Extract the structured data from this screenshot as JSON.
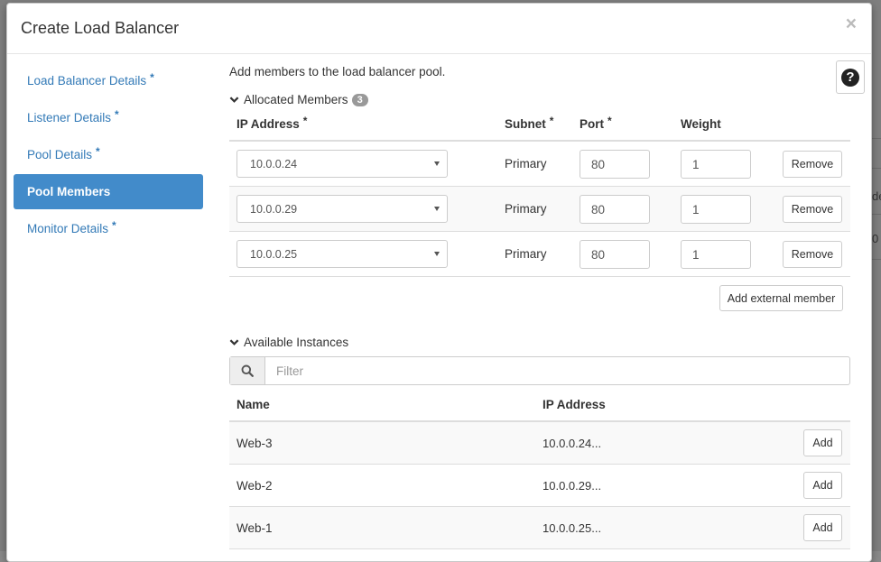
{
  "background": {
    "fragments": [
      "de",
      "0"
    ]
  },
  "modal": {
    "title": "Create Load Balancer",
    "close_label": "×"
  },
  "sidebar": {
    "items": [
      {
        "label": "Load Balancer Details",
        "required": "*"
      },
      {
        "label": "Listener Details",
        "required": "*"
      },
      {
        "label": "Pool Details",
        "required": "*"
      },
      {
        "label": "Pool Members",
        "required": ""
      },
      {
        "label": "Monitor Details",
        "required": "*"
      }
    ],
    "active_index": 3
  },
  "help": {
    "icon": "question-circle-icon",
    "label": "?"
  },
  "content": {
    "intro": "Add members to the load balancer pool.",
    "allocated": {
      "title": "Allocated Members",
      "count": "3",
      "headers": {
        "ip": "IP Address",
        "subnet": "Subnet",
        "port": "Port",
        "weight": "Weight",
        "required": "*"
      },
      "rows": [
        {
          "ip": "10.0.0.24",
          "subnet": "Primary",
          "port": "80",
          "weight": "1",
          "action": "Remove"
        },
        {
          "ip": "10.0.0.29",
          "subnet": "Primary",
          "port": "80",
          "weight": "1",
          "action": "Remove"
        },
        {
          "ip": "10.0.0.25",
          "subnet": "Primary",
          "port": "80",
          "weight": "1",
          "action": "Remove"
        }
      ],
      "add_external": "Add external member"
    },
    "available": {
      "title": "Available Instances",
      "filter_placeholder": "Filter",
      "headers": {
        "name": "Name",
        "ip": "IP Address"
      },
      "rows": [
        {
          "name": "Web-3",
          "ip": "10.0.0.24...",
          "action": "Add"
        },
        {
          "name": "Web-2",
          "ip": "10.0.0.29...",
          "action": "Add"
        },
        {
          "name": "Web-1",
          "ip": "10.0.0.25...",
          "action": "Add"
        }
      ]
    }
  },
  "colors": {
    "link": "#337ab7",
    "active": "#428bca",
    "badge": "#999999"
  }
}
